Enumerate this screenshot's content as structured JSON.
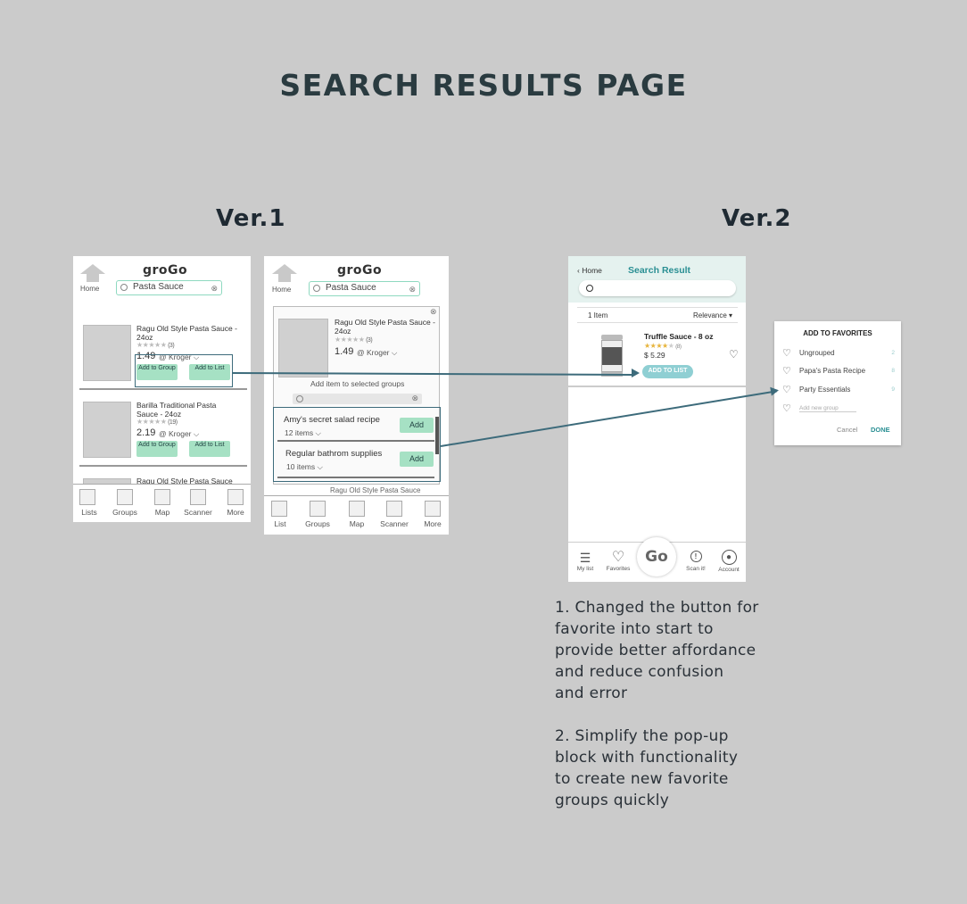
{
  "page_title": "SEARCH RESULTS PAGE",
  "ver1_label": "Ver.1",
  "ver2_label": "Ver.2",
  "v1a": {
    "logo": "groGo",
    "home": "Home",
    "search": "Pasta Sauce",
    "products": [
      {
        "name": "Ragu Old Style Pasta Sauce - 24oz",
        "reviews": "(3)",
        "price": "1.49",
        "store": "@ Kroger",
        "btn_group": "Add to Group",
        "btn_list": "Add to List"
      },
      {
        "name": "Barilla Traditional Pasta Sauce - 24oz",
        "reviews": "(19)",
        "price": "2.19",
        "store": "@ Kroger",
        "btn_group": "Add to Group",
        "btn_list": "Add to List"
      },
      {
        "name": "Ragu Old Style Pasta Sauce"
      }
    ],
    "tabs": [
      "Lists",
      "Groups",
      "Map",
      "Scanner",
      "More"
    ]
  },
  "v1b": {
    "logo": "groGo",
    "home": "Home",
    "search": "Pasta Sauce",
    "product": {
      "name": "Ragu Old Style Pasta Sauce - 24oz",
      "reviews": "(3)",
      "price": "1.49",
      "store": "@ Kroger"
    },
    "prompt": "Add item to selected groups",
    "groups": [
      {
        "name": "Amy's secret salad recipe",
        "count": "12 items",
        "btn": "Add"
      },
      {
        "name": "Regular bathrom supplies",
        "count": "10 items",
        "btn": "Add"
      }
    ],
    "peek": "Ragu Old Style Pasta Sauce",
    "tabs": [
      "List",
      "Groups",
      "Map",
      "Scanner",
      "More"
    ]
  },
  "v2": {
    "back": "Home",
    "title": "Search Result",
    "count": "1 Item",
    "sort": "Relevance",
    "product": {
      "name": "Truffle Sauce - 8 oz",
      "reviews": "(8)",
      "price": "$ 5.29",
      "btn": "ADD TO LIST"
    },
    "tabs": {
      "my_list": "My list",
      "favorites": "Favorites",
      "go": "Go",
      "scan": "Scan it!",
      "account": "Account"
    }
  },
  "fav_popup": {
    "title": "ADD TO FAVORITES",
    "rows": [
      {
        "name": "Ungrouped",
        "count": "2"
      },
      {
        "name": "Papa's Pasta Recipe",
        "count": "8"
      },
      {
        "name": "Party Essentials",
        "count": "9"
      }
    ],
    "new_placeholder": "Add new group",
    "cancel": "Cancel",
    "done": "DONE"
  },
  "notes": {
    "note1": "1. Changed the button for\nfavorite into start to\nprovide better affordance\nand reduce confusion\nand error",
    "note2": "2. Simplify the pop-up\nblock with functionality\nto create new favorite\ngroups quickly"
  },
  "colors": {
    "accent_green": "#a6e1c4",
    "teal": "#2a8f93",
    "connector": "#3d6b7b",
    "background": "#cbcbcb"
  }
}
